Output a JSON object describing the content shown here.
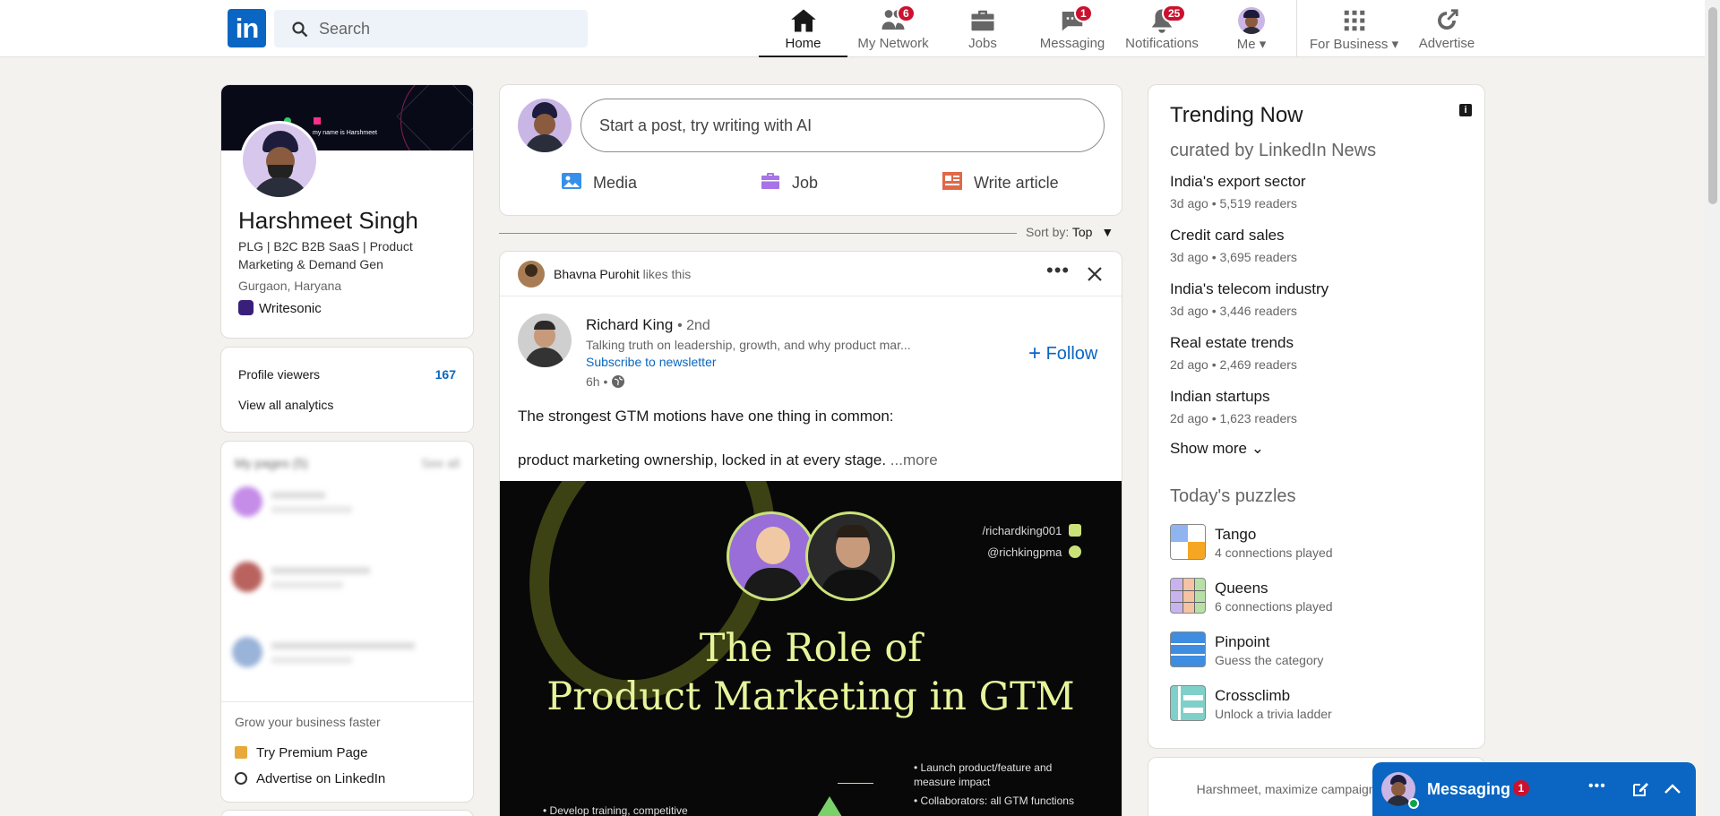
{
  "nav": {
    "search_placeholder": "Search",
    "items": [
      {
        "label": "Home"
      },
      {
        "label": "My Network",
        "badge": "6"
      },
      {
        "label": "Jobs"
      },
      {
        "label": "Messaging",
        "badge": "1"
      },
      {
        "label": "Notifications",
        "badge": "25"
      },
      {
        "label": "Me"
      },
      {
        "label": "For Business"
      },
      {
        "label": "Advertise"
      }
    ]
  },
  "profile": {
    "name": "Harshmeet Singh",
    "headline": "PLG | B2C B2B SaaS | Product Marketing & Demand Gen",
    "location": "Gurgaon, Haryana",
    "company": "Writesonic",
    "cover_text": "my name is Harshmeet"
  },
  "stats": {
    "viewers_label": "Profile viewers",
    "viewers_value": "167",
    "analytics_label": "View all analytics"
  },
  "pages": {
    "title": "My pages (5)",
    "see_all": "See all",
    "grow_label": "Grow your business faster",
    "premium_label": "Try Premium Page",
    "advertise_label": "Advertise on LinkedIn"
  },
  "composer": {
    "placeholder": "Start a post, try writing with AI",
    "media": "Media",
    "job": "Job",
    "article": "Write article"
  },
  "sort": {
    "label": "Sort by:",
    "value": "Top"
  },
  "post": {
    "liker": "Bhavna Purohit",
    "liker_action": "likes this",
    "author": "Richard King",
    "degree": "• 2nd",
    "tagline": "Talking truth on leadership, growth, and why product mar...",
    "subscribe": "Subscribe to newsletter",
    "time": "6h •",
    "follow": "Follow",
    "text1": "The strongest GTM motions have one thing in common:",
    "text2": "product marketing ownership, locked in at every stage.",
    "more": "...more",
    "image": {
      "handle1": "/richardking001",
      "handle2": "@richkingpma",
      "title_line1": "The Role of",
      "title_line2": "Product Marketing in GTM",
      "bullet1": "Launch product/feature and measure impact",
      "bullet2": "Collaborators: all GTM functions",
      "bullet3": "Develop training, competitive"
    }
  },
  "trending": {
    "title": "Trending Now",
    "subtitle": "curated by LinkedIn News",
    "items": [
      {
        "title": "India's export sector",
        "meta": "3d ago • 5,519 readers"
      },
      {
        "title": "Credit card sales",
        "meta": "3d ago • 3,695 readers"
      },
      {
        "title": "India's telecom industry",
        "meta": "3d ago • 3,446 readers"
      },
      {
        "title": "Real estate trends",
        "meta": "2d ago • 2,469 readers"
      },
      {
        "title": "Indian startups",
        "meta": "2d ago • 1,623 readers"
      }
    ],
    "show_more": "Show more"
  },
  "puzzles": {
    "title": "Today's puzzles",
    "items": [
      {
        "name": "Tango",
        "desc": "4 connections played"
      },
      {
        "name": "Queens",
        "desc": "6 connections played"
      },
      {
        "name": "Pinpoint",
        "desc": "Guess the category"
      },
      {
        "name": "Crossclimb",
        "desc": "Unlock a trivia ladder"
      }
    ]
  },
  "ad": {
    "text": "Harshmeet, maximize campaign r help of AI"
  },
  "messaging": {
    "label": "Messaging",
    "badge": "1"
  },
  "colors": {
    "brand": "#0a66c2",
    "badge": "#cb112d",
    "background": "#f4f2ee"
  }
}
